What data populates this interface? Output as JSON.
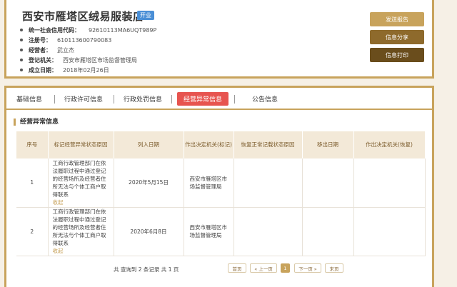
{
  "company": {
    "name": "西安市雁塔区绒易服装店",
    "status": "开业",
    "fields": [
      {
        "label": "统一社会信用代码：",
        "value": "92610113MA6UQT989P"
      },
      {
        "label": "注册号：",
        "value": "610113600790083"
      },
      {
        "label": "经营者：",
        "value": "武立杰"
      },
      {
        "label": "登记机关：",
        "value": "西安市雁塔区市场监督管理局"
      },
      {
        "label": "成立日期：",
        "value": "2018年02月26日"
      }
    ]
  },
  "actions": {
    "report": "发送报告",
    "share": "信息分享",
    "print": "信息打印"
  },
  "tabs": [
    "基础信息",
    "行政许可信息",
    "行政处罚信息",
    "经营异常信息",
    "公告信息"
  ],
  "active_tab": "经营异常信息",
  "section": {
    "title": "经营异常信息"
  },
  "table": {
    "headers": [
      "序号",
      "标记经营异常状态原因",
      "列入日期",
      "作出决定机关(标记)",
      "恢复正常记载状态原因",
      "移出日期",
      "作出决定机关(恢复)"
    ],
    "rows": [
      {
        "no": "1",
        "reason": "工商行政管理部门在依法履职过程中通过登记的经营场所及经营者住所无法与个体工商户取得联系",
        "collapse": "收起",
        "date": "2020年5月15日",
        "org": "西安市雁塔区市场监督管理局",
        "restore_reason": "",
        "remove_date": "",
        "restore_org": ""
      },
      {
        "no": "2",
        "reason": "工商行政管理部门在依法履职过程中通过登记的经营场所及经营者住所无法与个体工商户取得联系",
        "collapse": "收起",
        "date": "2020年6月8日",
        "org": "西安市雁塔区市场监督管理局",
        "restore_reason": "",
        "remove_date": "",
        "restore_org": ""
      }
    ]
  },
  "pagination": {
    "summary": "共 查询到 2 条记录 共 1 页",
    "first": "首页",
    "prev": "« 上一页",
    "current": "1",
    "next": "下一页 »",
    "last": "末页"
  }
}
